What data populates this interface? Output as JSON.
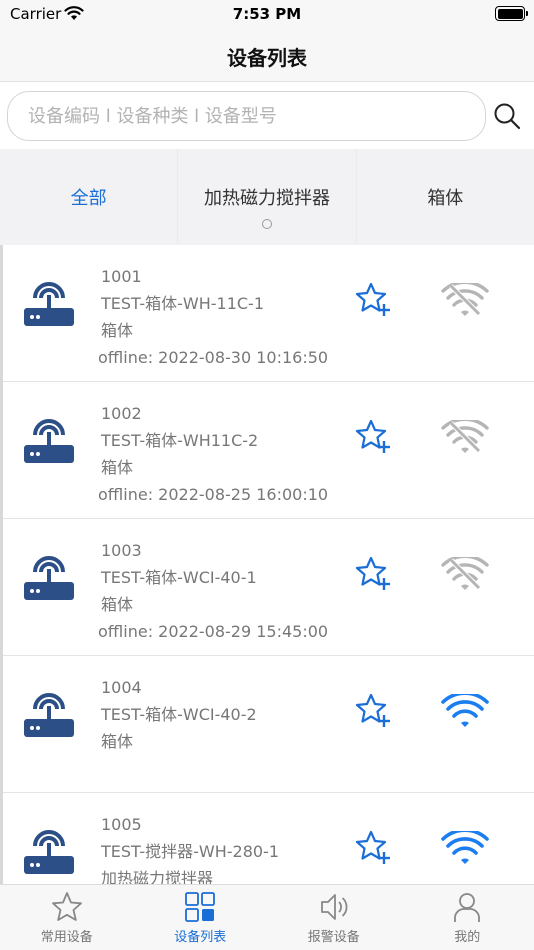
{
  "status_bar": {
    "carrier": "Carrier",
    "time": "7:53 PM",
    "battery_percent": 100
  },
  "nav": {
    "title": "设备列表"
  },
  "search": {
    "placeholder": "设备编码 l 设备种类 l 设备型号",
    "value": "",
    "icon": "search-icon"
  },
  "categories": [
    {
      "label": "全部",
      "active": true
    },
    {
      "label": "加热磁力搅拌器",
      "active": false
    },
    {
      "label": "箱体",
      "active": false
    }
  ],
  "devices": [
    {
      "code": "1001",
      "name": "TEST-箱体-WH-11C-1",
      "type": "箱体",
      "status": "offline: 2022-08-30 10:16:50",
      "online": false
    },
    {
      "code": "1002",
      "name": "TEST-箱体-WH11C-2",
      "type": "箱体",
      "status": "offline: 2022-08-25 16:00:10",
      "online": false
    },
    {
      "code": "1003",
      "name": "TEST-箱体-WCI-40-1",
      "type": "箱体",
      "status": "offline: 2022-08-29 15:45:00",
      "online": false
    },
    {
      "code": "1004",
      "name": "TEST-箱体-WCI-40-2",
      "type": "箱体",
      "status": "",
      "online": true
    },
    {
      "code": "1005",
      "name": "TEST-搅拌器-WH-280-1",
      "type": "加热磁力搅拌器",
      "status": "",
      "online": true
    }
  ],
  "tabbar": [
    {
      "label": "常用设备",
      "icon": "star-icon",
      "active": false
    },
    {
      "label": "设备列表",
      "icon": "grid-icon",
      "active": true
    },
    {
      "label": "报警设备",
      "icon": "speaker-icon",
      "active": false
    },
    {
      "label": "我的",
      "icon": "person-icon",
      "active": false
    }
  ],
  "colors": {
    "accent": "#1b6ed6",
    "device_icon": "#2b4f86",
    "wifi_online": "#1b7df0",
    "wifi_offline": "#b5b5b5",
    "favorite": "#1b6ed6"
  }
}
